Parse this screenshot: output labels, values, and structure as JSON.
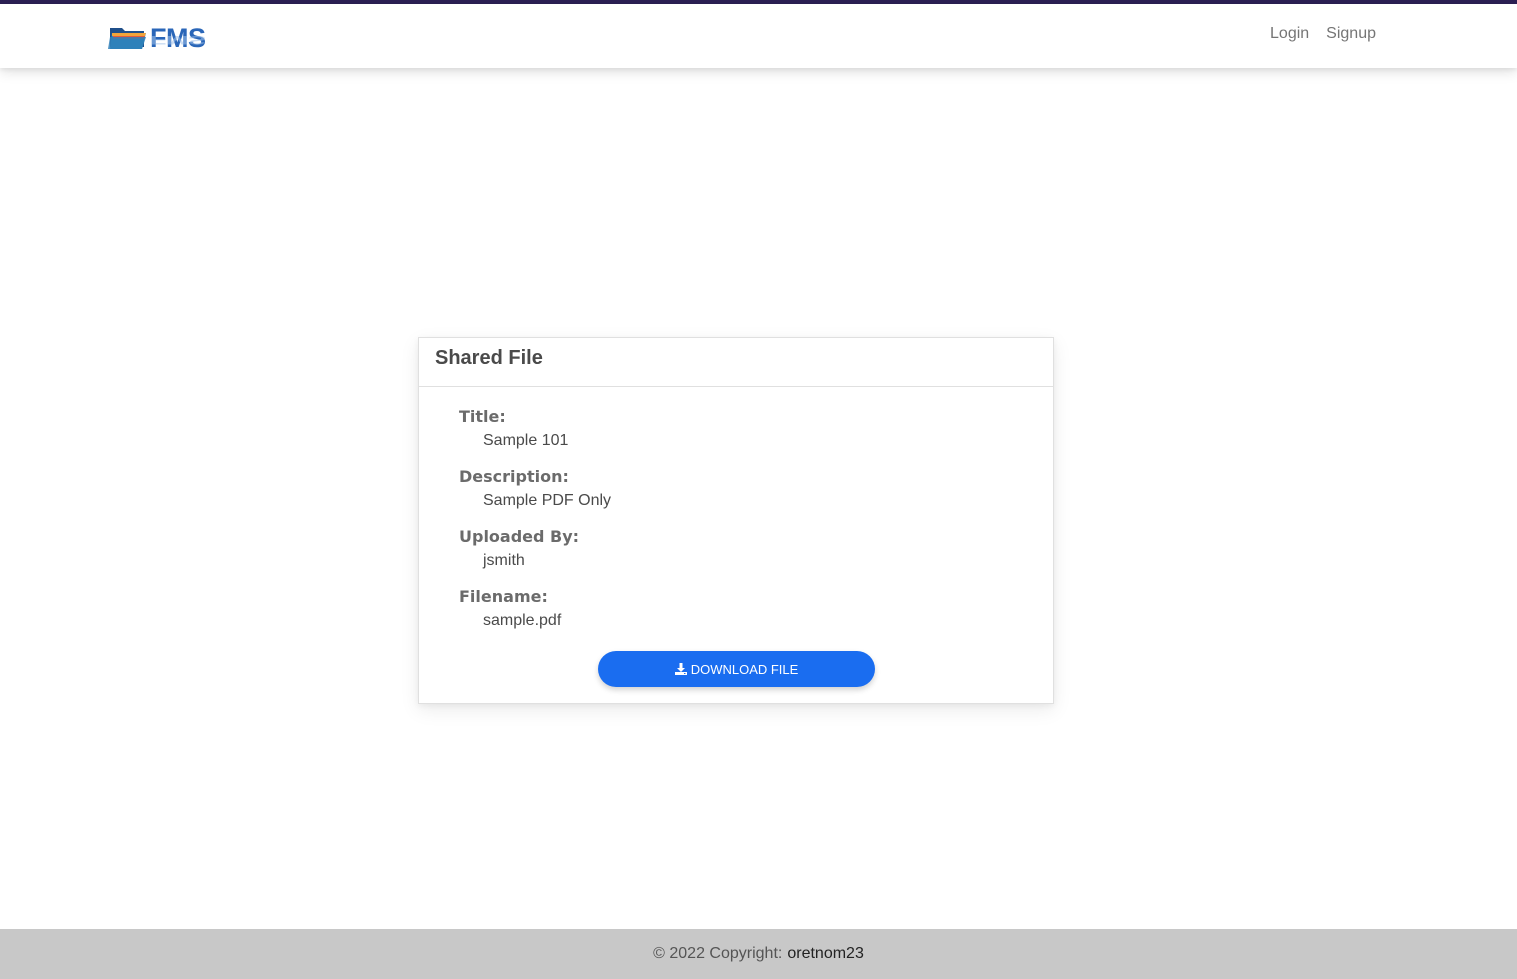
{
  "app": {
    "logo_text": "FMS",
    "colors": {
      "top_strip": "#2c2054",
      "accent": "#1a6df0",
      "footer_bg": "#c8c8c8"
    }
  },
  "nav": {
    "login": "Login",
    "signup": "Signup"
  },
  "card": {
    "title": "Shared File",
    "fields": [
      {
        "label": "Title:",
        "value": "Sample 101"
      },
      {
        "label": "Description:",
        "value": "Sample PDF Only"
      },
      {
        "label": "Uploaded By:",
        "value": "jsmith"
      },
      {
        "label": "Filename:",
        "value": "sample.pdf"
      }
    ],
    "download_label": "DOWNLOAD FILE",
    "download_icon": "download-icon"
  },
  "footer": {
    "copyright": "© 2022 Copyright:",
    "author": "oretnom23"
  }
}
